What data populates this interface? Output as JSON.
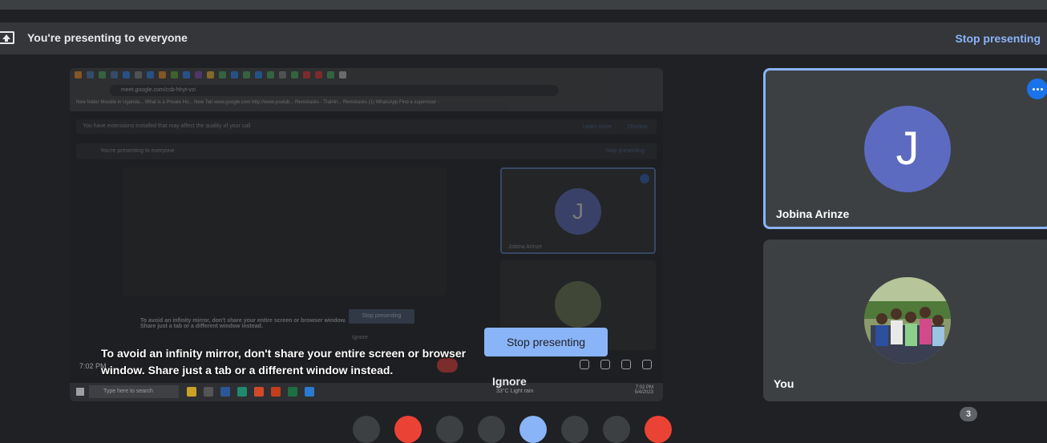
{
  "banner": {
    "title": "You're presenting to everyone",
    "stop_link": "Stop presenting",
    "icon": "present-to-all-icon"
  },
  "shared_screen": {
    "url": "meet.google.com/csb-hhyt-vzi",
    "bookmarks": "New folder   Moodle in Uganda...   What is a Private Ho...   New Tab   www.google.com   http://www.youtub...   Remotasks - Trainin...   Remotasks   (1) WhatsApp   Find a supervisor -",
    "extensions_notice": "You have extensions installed that may affect the quality of your call",
    "learn_more": "Learn more",
    "dismiss": "Dismiss",
    "presenting_notice": "You're presenting to everyone",
    "stop_presenting": "Stop presenting",
    "tile_name": "Jobina Arinze",
    "avatar_letter": "J",
    "small_warning": "To avoid an infinity mirror, don't share your entire screen or browser window. Share just a tab or a different window instead.",
    "small_stop": "Stop presenting",
    "small_ignore": "Ignore",
    "time": "7:02 PM",
    "taskbar_search": "Type here to search",
    "weather": "33°C  Light rain",
    "tray_time": "7:02 PM",
    "tray_date": "5/4/2023"
  },
  "warning": {
    "text": "To avoid an infinity mirror, don't share your entire screen or browser window. Share just a tab or a different window instead.",
    "stop_button": "Stop presenting",
    "ignore": "Ignore"
  },
  "participants": [
    {
      "name": "Jobina Arinze",
      "initial": "J",
      "avatar_color": "#5c6bc0",
      "active": true
    },
    {
      "name": "You",
      "avatar": "group-photo"
    }
  ],
  "participant_count": "3",
  "colors": {
    "accent": "#8ab4f8",
    "background": "#202124",
    "tile": "#3c4043",
    "more_button": "#1a73e8"
  }
}
